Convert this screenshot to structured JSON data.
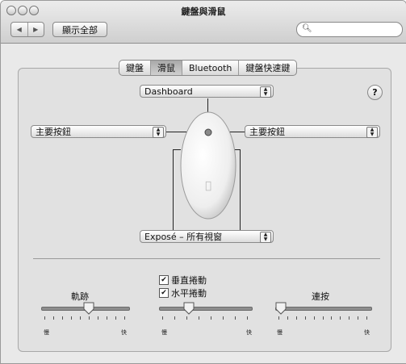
{
  "window": {
    "title": "鍵盤與滑鼠"
  },
  "toolbar": {
    "back_glyph": "◀",
    "forward_glyph": "▶",
    "show_all_label": "顯示全部",
    "search_placeholder": ""
  },
  "tabs": [
    {
      "label": "鍵盤",
      "selected": false
    },
    {
      "label": "滑鼠",
      "selected": true
    },
    {
      "label": "Bluetooth",
      "selected": false
    },
    {
      "label": "鍵盤快速鍵",
      "selected": false
    }
  ],
  "mouse_buttons": {
    "top": "Dashboard",
    "left": "主要按鈕",
    "right": "主要按鈕",
    "bottom": "Exposé – 所有視窗"
  },
  "help_label": "?",
  "tracking": {
    "label": "軌跡",
    "min_label": "慢",
    "max_label": "快",
    "value": 0.55
  },
  "scrolling": {
    "vertical_label": "垂直捲動",
    "vertical_checked": true,
    "horizontal_label": "水平捲動",
    "horizontal_checked": true,
    "min_label": "慢",
    "max_label": "快",
    "value": 0.3
  },
  "double_click": {
    "label": "連按",
    "min_label": "慢",
    "max_label": "快",
    "value": 0.0
  },
  "colors": {
    "window_bg": "#e9e9e9",
    "panel_bg": "#e1e1e1",
    "selected_tab": "#b0b0b0"
  }
}
